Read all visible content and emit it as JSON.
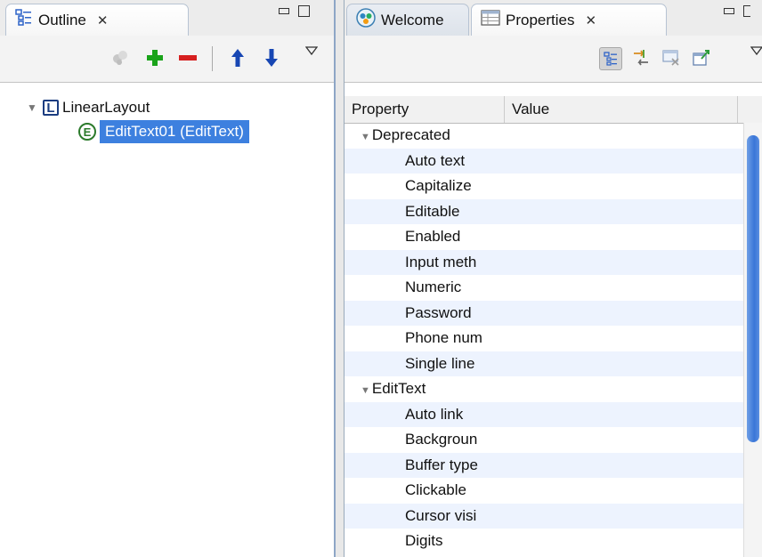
{
  "outline": {
    "tab_label": "Outline",
    "close_glyph": "✕",
    "tree": {
      "root_label": "LinearLayout",
      "root_icon_letter": "L",
      "child_label": "EditText01 (EditText)",
      "child_icon_letter": "E"
    },
    "toolbar_icons": [
      "duplicate-icon",
      "add-icon",
      "remove-icon",
      "move-up-icon",
      "move-down-icon"
    ]
  },
  "properties": {
    "tabs": [
      {
        "label": "Welcome",
        "icon": "welcome-icon"
      },
      {
        "label": "Properties",
        "icon": "properties-table-icon"
      }
    ],
    "close_glyph": "✕",
    "columns": {
      "property": "Property",
      "value": "Value"
    },
    "groups": [
      {
        "name": "Deprecated",
        "items": [
          "Auto text",
          "Capitalize",
          "Editable",
          "Enabled",
          "Input meth",
          "Numeric",
          "Password",
          "Phone num",
          "Single line"
        ]
      },
      {
        "name": "EditText",
        "items": [
          "Auto link",
          "Backgroun",
          "Buffer type",
          "Clickable",
          "Cursor visi",
          "Digits"
        ]
      }
    ]
  },
  "colors": {
    "selection": "#3d80df",
    "alt_row": "#edf3fe",
    "add_green": "#1aa31a",
    "remove_red": "#d61f1f",
    "arrow_blue": "#1746b3"
  }
}
